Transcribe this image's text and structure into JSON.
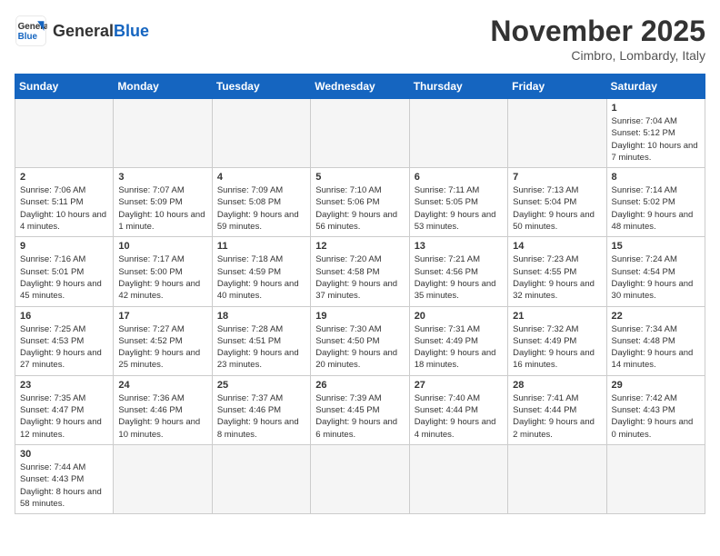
{
  "header": {
    "logo_text_general": "General",
    "logo_text_blue": "Blue",
    "month_title": "November 2025",
    "subtitle": "Cimbro, Lombardy, Italy"
  },
  "weekdays": [
    "Sunday",
    "Monday",
    "Tuesday",
    "Wednesday",
    "Thursday",
    "Friday",
    "Saturday"
  ],
  "weeks": [
    [
      {
        "day": "",
        "info": ""
      },
      {
        "day": "",
        "info": ""
      },
      {
        "day": "",
        "info": ""
      },
      {
        "day": "",
        "info": ""
      },
      {
        "day": "",
        "info": ""
      },
      {
        "day": "",
        "info": ""
      },
      {
        "day": "1",
        "info": "Sunrise: 7:04 AM\nSunset: 5:12 PM\nDaylight: 10 hours and 7 minutes."
      }
    ],
    [
      {
        "day": "2",
        "info": "Sunrise: 7:06 AM\nSunset: 5:11 PM\nDaylight: 10 hours and 4 minutes."
      },
      {
        "day": "3",
        "info": "Sunrise: 7:07 AM\nSunset: 5:09 PM\nDaylight: 10 hours and 1 minute."
      },
      {
        "day": "4",
        "info": "Sunrise: 7:09 AM\nSunset: 5:08 PM\nDaylight: 9 hours and 59 minutes."
      },
      {
        "day": "5",
        "info": "Sunrise: 7:10 AM\nSunset: 5:06 PM\nDaylight: 9 hours and 56 minutes."
      },
      {
        "day": "6",
        "info": "Sunrise: 7:11 AM\nSunset: 5:05 PM\nDaylight: 9 hours and 53 minutes."
      },
      {
        "day": "7",
        "info": "Sunrise: 7:13 AM\nSunset: 5:04 PM\nDaylight: 9 hours and 50 minutes."
      },
      {
        "day": "8",
        "info": "Sunrise: 7:14 AM\nSunset: 5:02 PM\nDaylight: 9 hours and 48 minutes."
      }
    ],
    [
      {
        "day": "9",
        "info": "Sunrise: 7:16 AM\nSunset: 5:01 PM\nDaylight: 9 hours and 45 minutes."
      },
      {
        "day": "10",
        "info": "Sunrise: 7:17 AM\nSunset: 5:00 PM\nDaylight: 9 hours and 42 minutes."
      },
      {
        "day": "11",
        "info": "Sunrise: 7:18 AM\nSunset: 4:59 PM\nDaylight: 9 hours and 40 minutes."
      },
      {
        "day": "12",
        "info": "Sunrise: 7:20 AM\nSunset: 4:58 PM\nDaylight: 9 hours and 37 minutes."
      },
      {
        "day": "13",
        "info": "Sunrise: 7:21 AM\nSunset: 4:56 PM\nDaylight: 9 hours and 35 minutes."
      },
      {
        "day": "14",
        "info": "Sunrise: 7:23 AM\nSunset: 4:55 PM\nDaylight: 9 hours and 32 minutes."
      },
      {
        "day": "15",
        "info": "Sunrise: 7:24 AM\nSunset: 4:54 PM\nDaylight: 9 hours and 30 minutes."
      }
    ],
    [
      {
        "day": "16",
        "info": "Sunrise: 7:25 AM\nSunset: 4:53 PM\nDaylight: 9 hours and 27 minutes."
      },
      {
        "day": "17",
        "info": "Sunrise: 7:27 AM\nSunset: 4:52 PM\nDaylight: 9 hours and 25 minutes."
      },
      {
        "day": "18",
        "info": "Sunrise: 7:28 AM\nSunset: 4:51 PM\nDaylight: 9 hours and 23 minutes."
      },
      {
        "day": "19",
        "info": "Sunrise: 7:30 AM\nSunset: 4:50 PM\nDaylight: 9 hours and 20 minutes."
      },
      {
        "day": "20",
        "info": "Sunrise: 7:31 AM\nSunset: 4:49 PM\nDaylight: 9 hours and 18 minutes."
      },
      {
        "day": "21",
        "info": "Sunrise: 7:32 AM\nSunset: 4:49 PM\nDaylight: 9 hours and 16 minutes."
      },
      {
        "day": "22",
        "info": "Sunrise: 7:34 AM\nSunset: 4:48 PM\nDaylight: 9 hours and 14 minutes."
      }
    ],
    [
      {
        "day": "23",
        "info": "Sunrise: 7:35 AM\nSunset: 4:47 PM\nDaylight: 9 hours and 12 minutes."
      },
      {
        "day": "24",
        "info": "Sunrise: 7:36 AM\nSunset: 4:46 PM\nDaylight: 9 hours and 10 minutes."
      },
      {
        "day": "25",
        "info": "Sunrise: 7:37 AM\nSunset: 4:46 PM\nDaylight: 9 hours and 8 minutes."
      },
      {
        "day": "26",
        "info": "Sunrise: 7:39 AM\nSunset: 4:45 PM\nDaylight: 9 hours and 6 minutes."
      },
      {
        "day": "27",
        "info": "Sunrise: 7:40 AM\nSunset: 4:44 PM\nDaylight: 9 hours and 4 minutes."
      },
      {
        "day": "28",
        "info": "Sunrise: 7:41 AM\nSunset: 4:44 PM\nDaylight: 9 hours and 2 minutes."
      },
      {
        "day": "29",
        "info": "Sunrise: 7:42 AM\nSunset: 4:43 PM\nDaylight: 9 hours and 0 minutes."
      }
    ],
    [
      {
        "day": "30",
        "info": "Sunrise: 7:44 AM\nSunset: 4:43 PM\nDaylight: 8 hours and 58 minutes."
      },
      {
        "day": "",
        "info": ""
      },
      {
        "day": "",
        "info": ""
      },
      {
        "day": "",
        "info": ""
      },
      {
        "day": "",
        "info": ""
      },
      {
        "day": "",
        "info": ""
      },
      {
        "day": "",
        "info": ""
      }
    ]
  ]
}
